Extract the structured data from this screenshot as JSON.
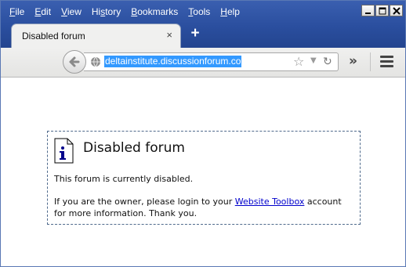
{
  "menubar": {
    "items": [
      "File",
      "Edit",
      "View",
      "History",
      "Bookmarks",
      "Tools",
      "Help"
    ],
    "accelerators": [
      "F",
      "E",
      "V",
      "s",
      "B",
      "T",
      "H"
    ]
  },
  "tab": {
    "title": "Disabled forum",
    "close_glyph": "×"
  },
  "new_tab_glyph": "+",
  "urlbar": {
    "url": "deltainstitute.discussionforum.co"
  },
  "toolbar": {
    "overflow_glyph": "»"
  },
  "notice": {
    "title": "Disabled forum",
    "message": "This forum is currently disabled.",
    "owner_prefix": "If you are the owner, please login to your ",
    "link_text": "Website Toolbox",
    "owner_suffix": " account for more information. Thank you."
  },
  "icons": {
    "info": "info-document-icon",
    "back": "back-arrow-icon",
    "globe": "globe-icon",
    "bookmark": "star-icon",
    "reload": "reload-icon",
    "menu": "hamburger-menu-icon"
  },
  "colors": {
    "titlebar": "#2a4e9e",
    "selection": "#3399ff",
    "link": "#0000cc",
    "notice_border": "#4f6a8c"
  }
}
